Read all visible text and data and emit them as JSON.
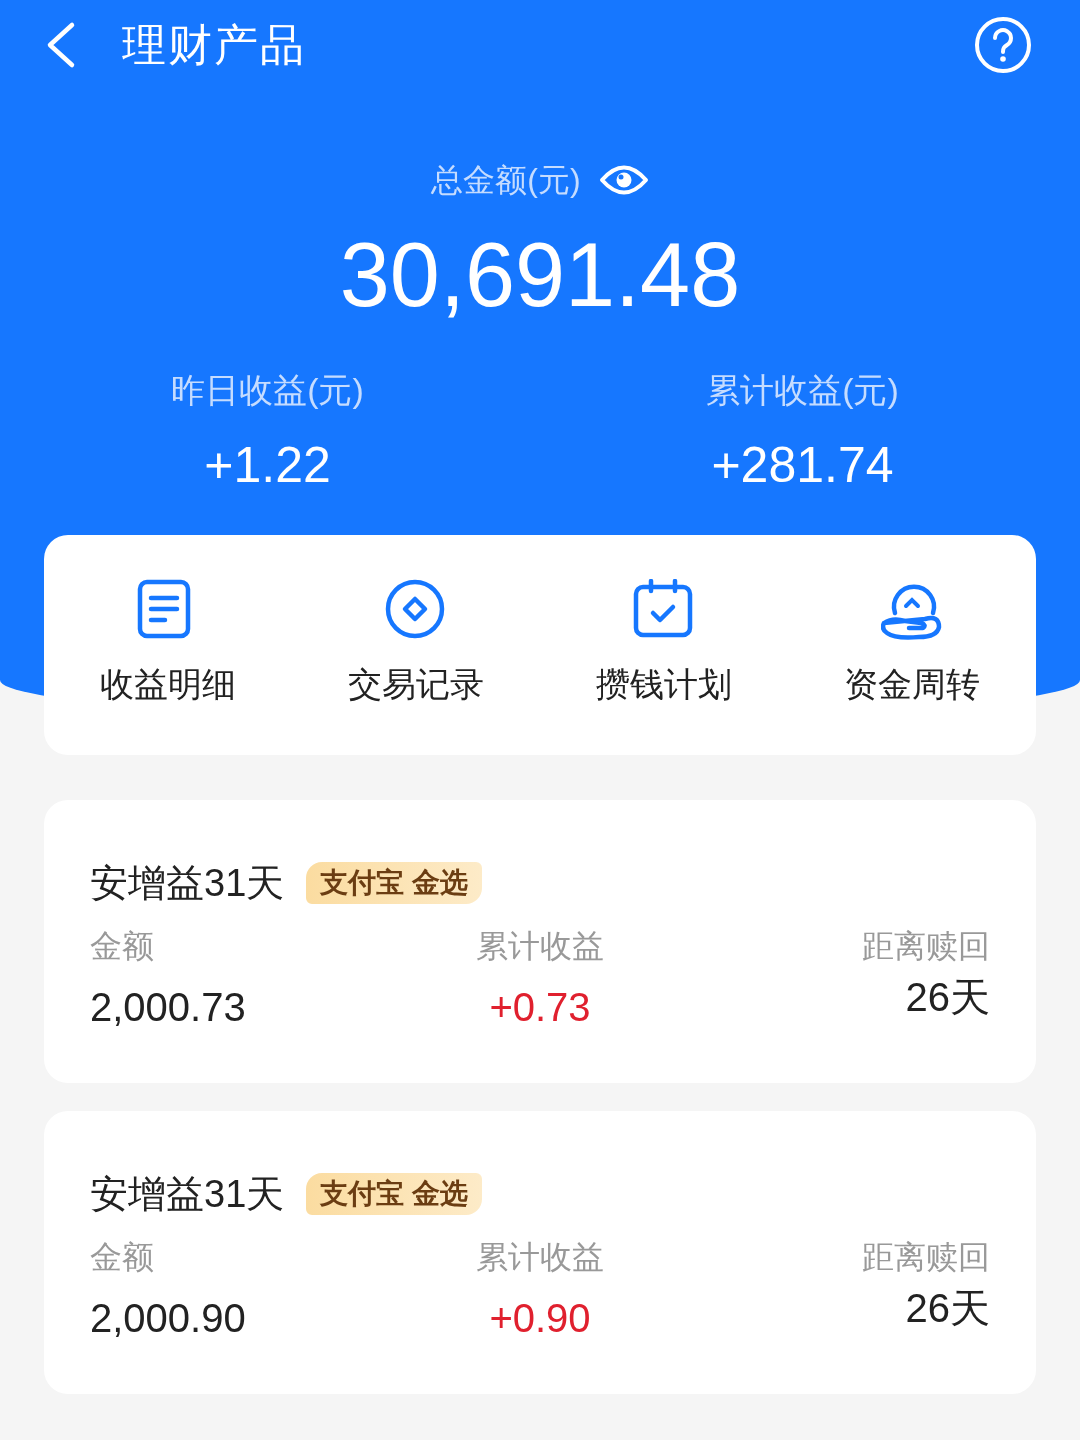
{
  "header": {
    "title": "理财产品"
  },
  "summary": {
    "total_label": "总金额(元)",
    "total": "30,691.48",
    "stats": [
      {
        "label": "昨日收益(元)",
        "value": "+1.22"
      },
      {
        "label": "累计收益(元)",
        "value": "+281.74"
      }
    ]
  },
  "shortcuts": [
    {
      "kind": "document",
      "label": "收益明细"
    },
    {
      "kind": "coin",
      "label": "交易记录"
    },
    {
      "kind": "calendar",
      "label": "攒钱计划"
    },
    {
      "kind": "hand",
      "label": "资金周转"
    }
  ],
  "products": [
    {
      "name": "安增益31天",
      "badge": "支付宝 金选",
      "fields": [
        {
          "label": "金额",
          "value": "2,000.73",
          "kind": "plain"
        },
        {
          "label": "累计收益",
          "value": "+0.73",
          "kind": "gain"
        },
        {
          "label": "距离赎回",
          "value": "26天",
          "kind": "plain"
        }
      ]
    },
    {
      "name": "安增益31天",
      "badge": "支付宝 金选",
      "fields": [
        {
          "label": "金额",
          "value": "2,000.90",
          "kind": "plain"
        },
        {
          "label": "累计收益",
          "value": "+0.90",
          "kind": "gain"
        },
        {
          "label": "距离赎回",
          "value": "26天",
          "kind": "plain"
        }
      ]
    }
  ]
}
